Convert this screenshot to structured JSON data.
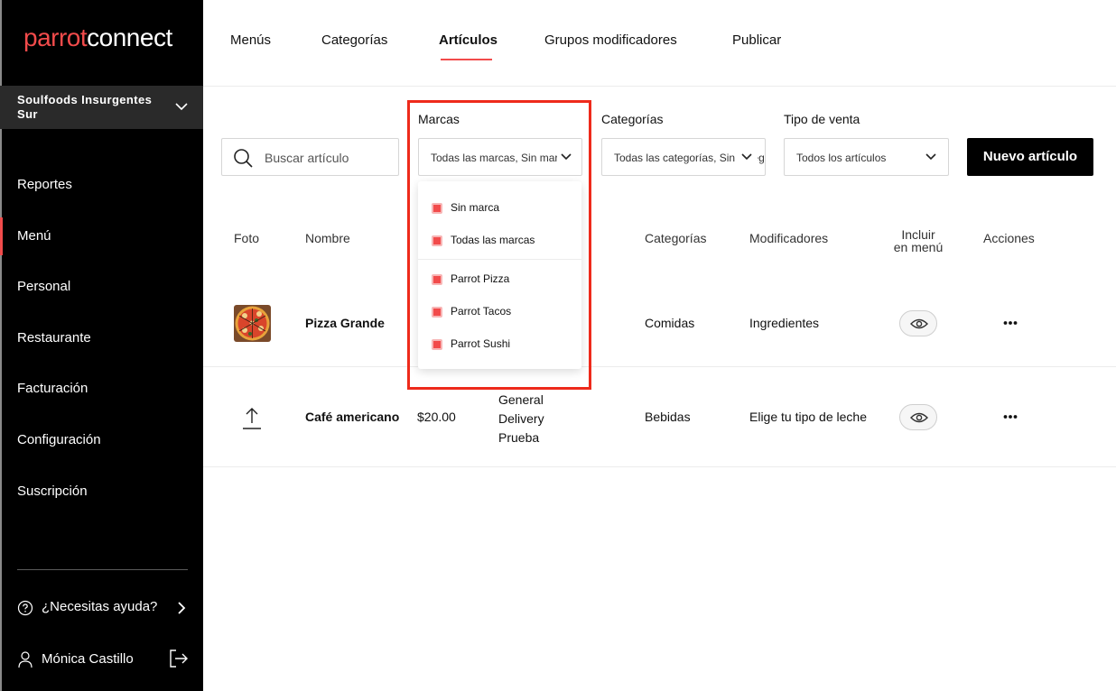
{
  "sidebar": {
    "logo_a": "parrot",
    "logo_b": "connect",
    "store_name": "Soulfoods Insurgentes Sur",
    "items": [
      {
        "label": "Reportes"
      },
      {
        "label": "Menú"
      },
      {
        "label": "Personal"
      },
      {
        "label": "Restaurante"
      },
      {
        "label": "Facturación"
      },
      {
        "label": "Configuración"
      },
      {
        "label": "Suscripción"
      }
    ],
    "help_label": "¿Necesitas ayuda?",
    "user_name": "Mónica Castillo"
  },
  "tabs": [
    {
      "label": "Menús"
    },
    {
      "label": "Categorías"
    },
    {
      "label": "Artículos"
    },
    {
      "label": "Grupos modificadores"
    },
    {
      "label": "Publicar"
    }
  ],
  "filters": {
    "search_placeholder": "Buscar artículo",
    "brands_label": "Marcas",
    "brands_value": "Todas las marcas, Sin marca",
    "categories_label": "Categorías",
    "categories_value": "Todas las categorías, Sin categoría",
    "sale_type_label": "Tipo de venta",
    "sale_type_value": "Todos los artículos",
    "new_button": "Nuevo artículo"
  },
  "brands_dropdown": [
    {
      "label": "Sin marca"
    },
    {
      "label": "Todas las marcas"
    },
    {
      "label": "Parrot Pizza"
    },
    {
      "label": "Parrot Tacos"
    },
    {
      "label": "Parrot Sushi"
    }
  ],
  "table": {
    "headers": {
      "photo": "Foto",
      "name": "Nombre",
      "categories": "Categorías",
      "modifiers": "Modificadores",
      "include_l1": "Incluir",
      "include_l2": "en menú",
      "actions": "Acciones"
    },
    "rows": [
      {
        "name": "Pizza Grande",
        "categories": "Comidas",
        "modifiers": "Ingredientes"
      },
      {
        "name": "Café americano",
        "price": "$20.00",
        "menus": [
          "General",
          "Delivery",
          "Prueba"
        ],
        "categories": "Bebidas",
        "modifiers": "Elige tu tipo de leche"
      }
    ]
  }
}
